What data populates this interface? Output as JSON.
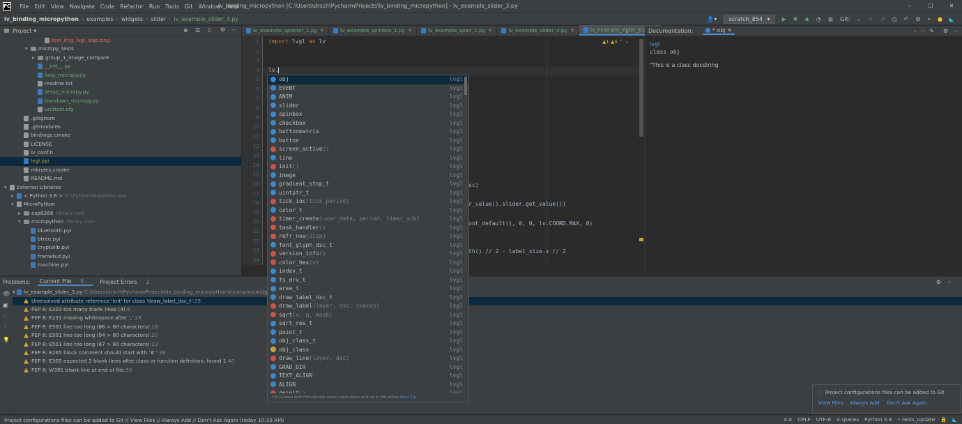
{
  "titlebar": {
    "menu": [
      "File",
      "Edit",
      "View",
      "Navigate",
      "Code",
      "Refactor",
      "Run",
      "Tools",
      "Git",
      "Window",
      "Help"
    ],
    "title": "lv_binding_micropython [C:\\Users\\drsch\\PycharmProjects\\lv_binding_micropython] - lv_example_slider_3.py"
  },
  "breadcrumb": [
    "lv_binding_micropython",
    "examples",
    "widgets",
    "slider",
    "lv_example_slider_3.py"
  ],
  "toolbar": {
    "run_config": "scratch_854",
    "git_label": "Git:"
  },
  "project": {
    "title": "Project",
    "tree": [
      {
        "name": "test_img_lvgl_logo.png",
        "indent": 5,
        "type": "png",
        "color": "#e06c5e"
      },
      {
        "name": "micropy_tests",
        "indent": 3,
        "type": "folder",
        "arrow": "▾"
      },
      {
        "name": "group_1_image_compare",
        "indent": 4,
        "type": "folder",
        "arrow": "▸"
      },
      {
        "name": "__init__.py",
        "indent": 4,
        "type": "py",
        "color": "#6aab73"
      },
      {
        "name": "loop_micropy.py",
        "indent": 4,
        "type": "py",
        "color": "#6aab73"
      },
      {
        "name": "readme.txt",
        "indent": 4,
        "type": "txt"
      },
      {
        "name": "setup_micropy.py",
        "indent": 4,
        "type": "py",
        "color": "#6aab73"
      },
      {
        "name": "teardown_micropy.py",
        "indent": 4,
        "type": "py",
        "color": "#6aab73"
      },
      {
        "name": "unittest.cfg",
        "indent": 4,
        "type": "txt",
        "color": "#6aab73"
      },
      {
        "name": ".gitignore",
        "indent": 2,
        "type": "txt"
      },
      {
        "name": ".gitmodules",
        "indent": 2,
        "type": "txt"
      },
      {
        "name": "bindings.cmake",
        "indent": 2,
        "type": "txt"
      },
      {
        "name": "LICENSE",
        "indent": 2,
        "type": "txt"
      },
      {
        "name": "lv_conf.h",
        "indent": 2,
        "type": "txt"
      },
      {
        "name": "lvgl.pyi",
        "indent": 2,
        "type": "py",
        "color": "#c9a43b",
        "selected": true
      },
      {
        "name": "mkrules.cmake",
        "indent": 2,
        "type": "txt"
      },
      {
        "name": "README.md",
        "indent": 2,
        "type": "txt"
      },
      {
        "name": "External Libraries",
        "indent": 0,
        "type": "lib",
        "arrow": "▾"
      },
      {
        "name": "< Python 3.8 >",
        "indent": 1,
        "type": "py",
        "arrow": "▸",
        "extra": "C:\\Python38\\python.exe"
      },
      {
        "name": "MicroPython",
        "indent": 1,
        "type": "lib",
        "arrow": "▾"
      },
      {
        "name": "esp8266",
        "indent": 2,
        "type": "folder",
        "arrow": "▸",
        "extra": "library root"
      },
      {
        "name": "micropython",
        "indent": 2,
        "type": "folder",
        "arrow": "▾",
        "extra": "library root"
      },
      {
        "name": "bluetooth.pyi",
        "indent": 3,
        "type": "py"
      },
      {
        "name": "btree.pyi",
        "indent": 3,
        "type": "py"
      },
      {
        "name": "cryptolib.pyi",
        "indent": 3,
        "type": "py"
      },
      {
        "name": "framebuf.pyi",
        "indent": 3,
        "type": "py"
      },
      {
        "name": "machine.pyi",
        "indent": 3,
        "type": "py"
      }
    ]
  },
  "tabs": [
    {
      "label": "lv_example_spinner_1.py"
    },
    {
      "label": "lv_example_spinbox_1.py"
    },
    {
      "label": "lv_example_span_1.py"
    },
    {
      "label": "lv_example_slider_4.py"
    },
    {
      "label": "lv_example_slider_3.py",
      "active": true
    }
  ],
  "editor": {
    "line_numbers": [
      "1",
      "2",
      "3",
      "4",
      "5",
      "6",
      "7",
      "8",
      "9",
      "10",
      "11",
      "12",
      "13",
      "14",
      "15",
      "16",
      "17",
      "18",
      "19",
      "20",
      "21",
      "22",
      "23",
      "24"
    ],
    "line1_kw1": "import",
    "line1_rest": " lvgl ",
    "line1_kw2": "as",
    "line1_alias": " lv",
    "line4": "lv.",
    "frag1": "sc)",
    "frag2": "r_value(),slider.get_value())",
    "frag3": "ont_default(), 0, 0, lv.COORD.MAX, 0)",
    "frag4": "th() // 2 - label_size.x // 2",
    "inspection": "▲1 ▲6"
  },
  "completion": {
    "items": [
      {
        "name": "obj",
        "kind": "c",
        "sig": "",
        "src": "lvgl",
        "selected": true
      },
      {
        "name": "EVENT",
        "kind": "c",
        "sig": "",
        "src": "lvgl"
      },
      {
        "name": "ANIM",
        "kind": "c",
        "sig": "",
        "src": "lvgl"
      },
      {
        "name": "slider",
        "kind": "c",
        "sig": "",
        "src": "lvgl"
      },
      {
        "name": "spinbox",
        "kind": "c",
        "sig": "",
        "src": "lvgl"
      },
      {
        "name": "checkbox",
        "kind": "c",
        "sig": "",
        "src": "lvgl"
      },
      {
        "name": "buttonmatrix",
        "kind": "c",
        "sig": "",
        "src": "lvgl"
      },
      {
        "name": "button",
        "kind": "c",
        "sig": "",
        "src": "lvgl"
      },
      {
        "name": "screen_active",
        "kind": "f",
        "sig": "()",
        "src": "lvgl"
      },
      {
        "name": "line",
        "kind": "c",
        "sig": "",
        "src": "lvgl"
      },
      {
        "name": "init",
        "kind": "f",
        "sig": "()",
        "src": "lvgl"
      },
      {
        "name": "image",
        "kind": "c",
        "sig": "",
        "src": "lvgl"
      },
      {
        "name": "gradient_stop_t",
        "kind": "c",
        "sig": "",
        "src": "lvgl"
      },
      {
        "name": "uintptr_t",
        "kind": "c",
        "sig": "",
        "src": "lvgl"
      },
      {
        "name": "tick_inc",
        "kind": "f",
        "sig": "(tick_period)",
        "src": "lvgl"
      },
      {
        "name": "color_t",
        "kind": "c",
        "sig": "",
        "src": "lvgl"
      },
      {
        "name": "timer_create",
        "kind": "f",
        "sig": "(user_data, period, timer_xcb)",
        "src": "lvgl"
      },
      {
        "name": "task_handler",
        "kind": "f",
        "sig": "()",
        "src": "lvgl"
      },
      {
        "name": "refr_now",
        "kind": "f",
        "sig": "(disp)",
        "src": "lvgl"
      },
      {
        "name": "font_glyph_dsc_t",
        "kind": "c",
        "sig": "",
        "src": "lvgl"
      },
      {
        "name": "version_info",
        "kind": "f",
        "sig": "()",
        "src": "lvgl"
      },
      {
        "name": "color_hex",
        "kind": "f",
        "sig": "(v)",
        "src": "lvgl"
      },
      {
        "name": "indev_t",
        "kind": "c",
        "sig": "",
        "src": "lvgl"
      },
      {
        "name": "fs_drv_t",
        "kind": "c",
        "sig": "",
        "src": "lvgl"
      },
      {
        "name": "area_t",
        "kind": "c",
        "sig": "",
        "src": "lvgl"
      },
      {
        "name": "draw_label_dsc_t",
        "kind": "c",
        "sig": "",
        "src": "lvgl"
      },
      {
        "name": "draw_label",
        "kind": "f",
        "sig": "(layer, dsc, coords)",
        "src": "lvgl"
      },
      {
        "name": "sqrt",
        "kind": "f",
        "sig": "(x, q, mask)",
        "src": "lvgl"
      },
      {
        "name": "sqrt_res_t",
        "kind": "c",
        "sig": "",
        "src": "lvgl"
      },
      {
        "name": "point_t",
        "kind": "c",
        "sig": "",
        "src": "lvgl"
      },
      {
        "name": "obj_class_t",
        "kind": "c",
        "sig": "",
        "src": "lvgl"
      },
      {
        "name": "obj_class",
        "kind": "v",
        "sig": "",
        "src": "lvgl"
      },
      {
        "name": "draw_line",
        "kind": "f",
        "sig": "(layer, dsc)",
        "src": "lvgl"
      },
      {
        "name": "GRAD_DIR",
        "kind": "c",
        "sig": "",
        "src": "lvgl"
      },
      {
        "name": "TEXT_ALIGN",
        "kind": "c",
        "sig": "",
        "src": "lvgl"
      },
      {
        "name": "ALIGN",
        "kind": "c",
        "sig": "",
        "src": "lvgl"
      },
      {
        "name": "deinit",
        "kind": "f",
        "sig": "()",
        "src": "lvgl"
      }
    ],
    "footer_text": "Ctrl+Down and Ctrl+Up will move caret down and up in the editor",
    "footer_link": "Next Tip"
  },
  "documentation": {
    "title": "Documentation:",
    "tab": "* obj",
    "module": "lvgl",
    "signature": "class obj",
    "docstring": "\"This is a class docstring"
  },
  "problems": {
    "title": "Problems:",
    "tab_current": "Current File",
    "tab_current_count": "9",
    "tab_project": "Project Errors",
    "tab_project_count": "2",
    "file": "lv_example_slider_3.py",
    "file_path": "C:\\Users\\drsch\\PycharmProjects\\lv_binding_micropython\\examples\\widgets\\slider",
    "items": [
      {
        "text": "Unresolved attribute reference 'init' for class 'draw_label_dsc_t'",
        "line": ":29",
        "selected": true
      },
      {
        "text": "PEP 8: E303 too many blank lines (4)",
        "line": ":6"
      },
      {
        "text": "PEP 8: E231 missing whitespace after ','",
        "line": ":18"
      },
      {
        "text": "PEP 8: E501 line too long (86 > 80 characters)",
        "line": ":18"
      },
      {
        "text": "PEP 8: E501 line too long (94 > 80 characters)",
        "line": ":20"
      },
      {
        "text": "PEP 8: E501 line too long (87 > 80 characters)",
        "line": ":23"
      },
      {
        "text": "PEP 8: E265 block comment should start with '# '",
        "line": ":38"
      },
      {
        "text": "PEP 8: E305 expected 2 blank lines after class or function definition, found 1",
        "line": ":40"
      },
      {
        "text": "PEP 8: W391 blank line at end of file",
        "line": ":50"
      }
    ]
  },
  "notification": {
    "message": "Project configurations files can be added to Git",
    "actions": [
      "View Files",
      "Always Add",
      "Don't Ask Again"
    ]
  },
  "status": {
    "message": "Project configurations files can be added to Git // View Files // Always Add // Don't Ask Again (today 10:10 AM)",
    "position": "4:4",
    "line_sep": "CRLF",
    "encoding": "UTF-8",
    "indent": "4 spaces",
    "interpreter": "Python 3.8",
    "branch": "tests_update"
  }
}
